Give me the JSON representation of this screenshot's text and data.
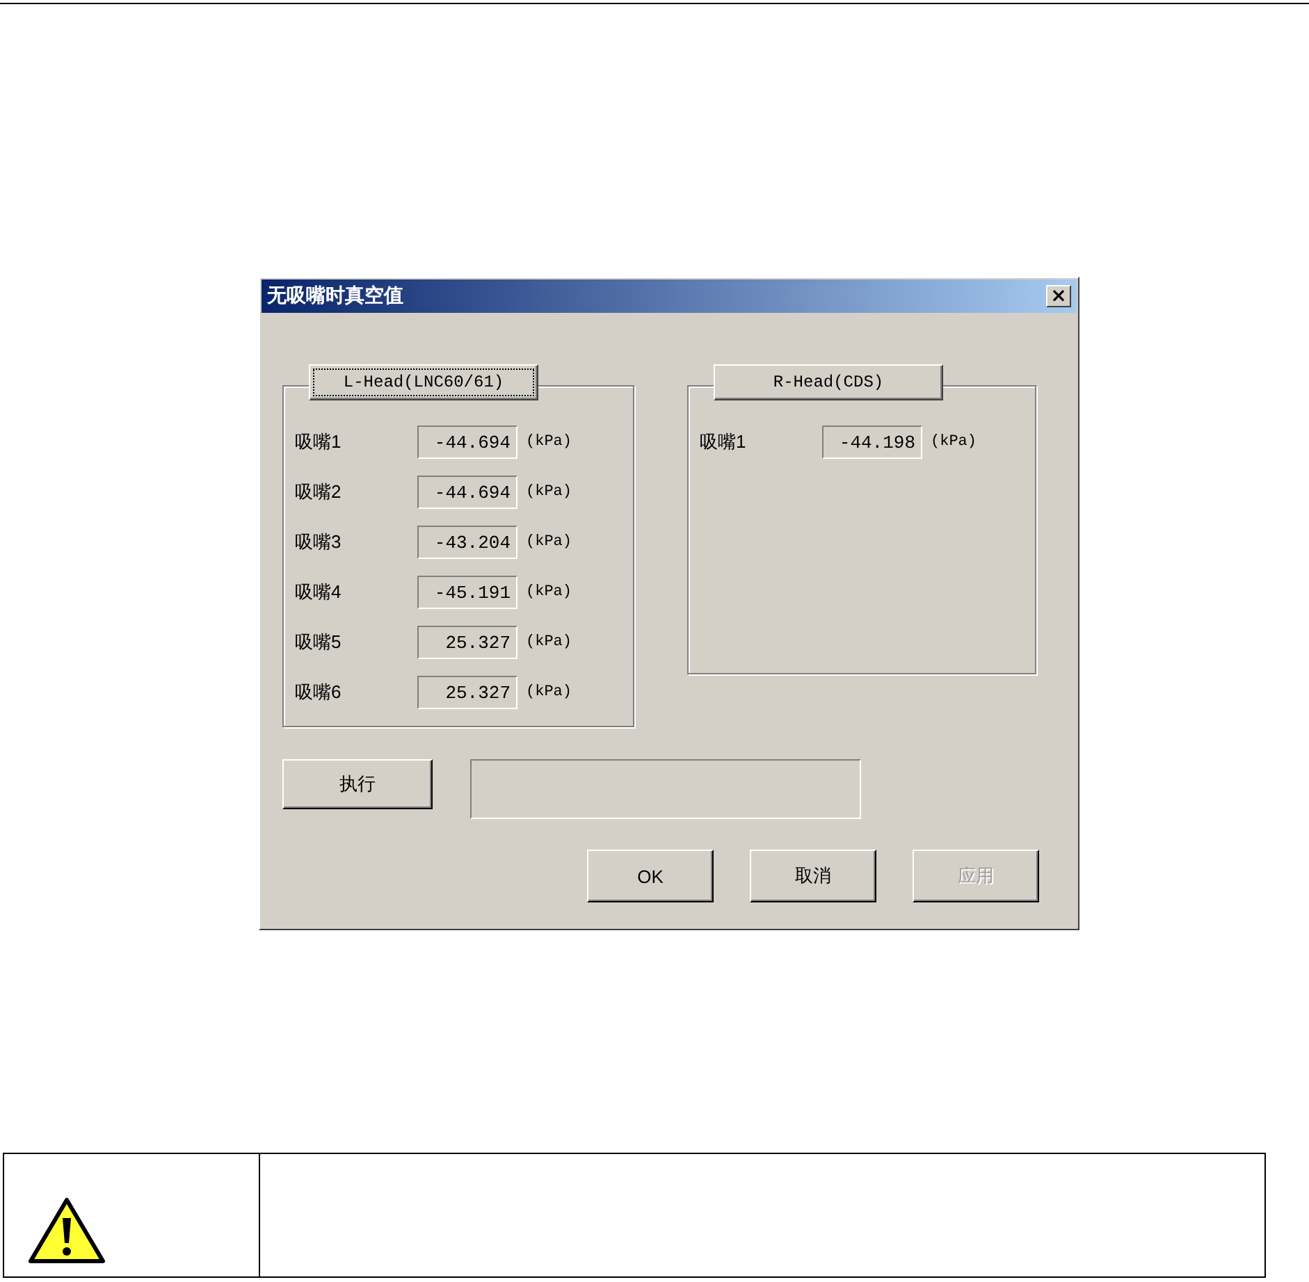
{
  "window": {
    "title": "无吸嘴时真空值",
    "close": "×"
  },
  "groups": [
    {
      "button": "L-Head(LNC60/61)",
      "focused": true,
      "rows": [
        {
          "label": "吸嘴1",
          "value": "-44.694",
          "unit": "(kPa)"
        },
        {
          "label": "吸嘴2",
          "value": "-44.694",
          "unit": "(kPa)"
        },
        {
          "label": "吸嘴3",
          "value": "-43.204",
          "unit": "(kPa)"
        },
        {
          "label": "吸嘴4",
          "value": "-45.191",
          "unit": "(kPa)"
        },
        {
          "label": "吸嘴5",
          "value": "25.327",
          "unit": "(kPa)"
        },
        {
          "label": "吸嘴6",
          "value": "25.327",
          "unit": "(kPa)"
        }
      ]
    },
    {
      "button": "R-Head(CDS)",
      "focused": false,
      "rows": [
        {
          "label": "吸嘴1",
          "value": "-44.198",
          "unit": "(kPa)"
        }
      ]
    }
  ],
  "execute_button": "执行",
  "buttons": [
    {
      "label": "OK",
      "disabled": false
    },
    {
      "label": "取消",
      "disabled": false
    },
    {
      "label": "应用",
      "disabled": true
    }
  ]
}
